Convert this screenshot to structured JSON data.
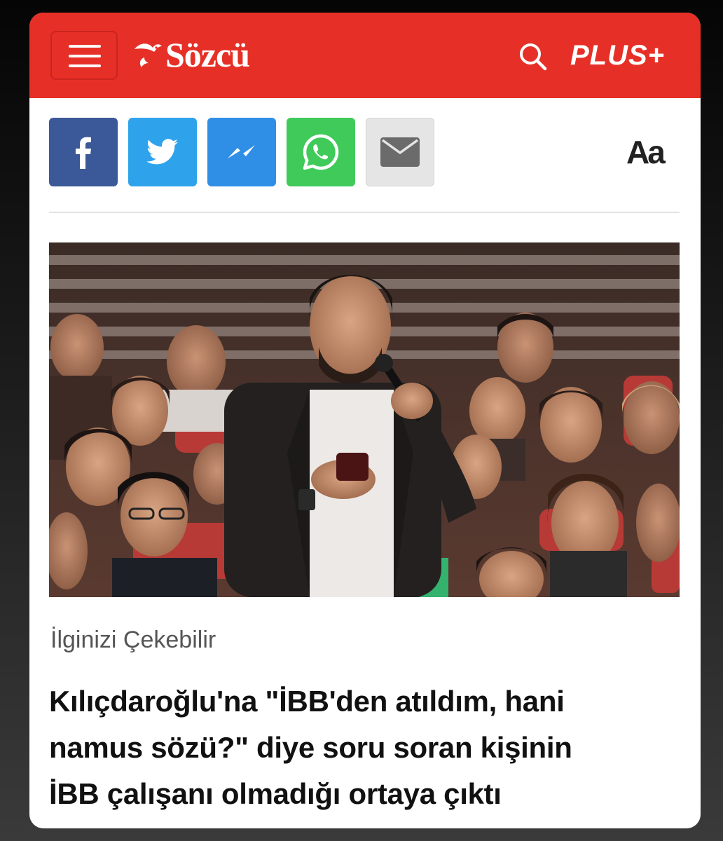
{
  "header": {
    "brand": "Sözcü",
    "plus_label": "PLUS+",
    "background_color": "#e63027"
  },
  "share": {
    "buttons": [
      {
        "name": "facebook",
        "icon": "facebook-icon",
        "color": "#3b5998"
      },
      {
        "name": "twitter",
        "icon": "twitter-icon",
        "color": "#2ea3ec"
      },
      {
        "name": "messenger",
        "icon": "messenger-icon",
        "color": "#2f8fe6"
      },
      {
        "name": "whatsapp",
        "icon": "whatsapp-icon",
        "color": "#3fca5a"
      },
      {
        "name": "email",
        "icon": "mail-icon",
        "color": "#e5e5e5"
      }
    ],
    "font_size_label": "Aa"
  },
  "article": {
    "section_label": "İlginizi Çekebilir",
    "headline_lines": [
      "Kılıçdaroğlu'na \"İBB'den atıldım, hani",
      "namus sözü?\" diye soru soran kişinin",
      "İBB çalışanı olmadığı ortaya çıktı"
    ]
  }
}
